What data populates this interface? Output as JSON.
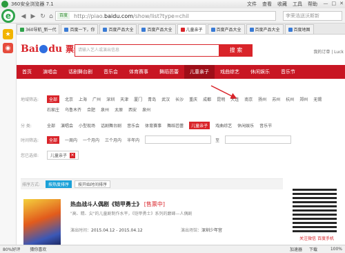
{
  "browser": {
    "title": "360安全浏览器 7.1",
    "menus": [
      "文件",
      "查看",
      "收藏",
      "工具",
      "帮助"
    ],
    "url_badge": "百度",
    "url_prefix": "http://piao.",
    "url_domain": "baidu.com",
    "url_path": "/show/list?type=chil",
    "search_placeholder": "李荣浩送沃斯新",
    "tabs": [
      {
        "label": "360导航_新一代"
      },
      {
        "label": "百度一下，你"
      },
      {
        "label": "百度产品大全"
      },
      {
        "label": "百度产品大全"
      },
      {
        "label": "儿童亲子"
      },
      {
        "label": "百度产品大全"
      },
      {
        "label": "百度产品大全"
      },
      {
        "label": "百度地图"
      }
    ]
  },
  "page": {
    "logo_text": "Bai",
    "logo_text2": "du",
    "logo_sub": "票务",
    "search_placeholder": "请输入艺人或演出信息",
    "search_button": "搜 索",
    "header_links": "我的订单 | Luck",
    "nav": [
      "首页",
      "演唱会",
      "话剧舞台剧",
      "音乐会",
      "体育赛事",
      "舞蹈芭蕾",
      "儿童亲子",
      "戏曲综艺",
      "休闲娱乐",
      "音乐节"
    ],
    "filters": {
      "city_label": "地域筛选:",
      "cities_row1": [
        "全部",
        "北京",
        "上海",
        "广州",
        "深圳",
        "天津",
        "厦门",
        "青岛",
        "武汉",
        "长沙",
        "重庆",
        "成都",
        "昆明",
        "大连",
        "南京",
        "扬州",
        "苏州",
        "杭州",
        "郑州",
        "无锡",
        "福州"
      ],
      "cities_row2": [
        "石家庄",
        "乌鲁木齐",
        "合肥",
        "泉州",
        "太原",
        "西安",
        "泉州"
      ],
      "category_label": "分   类:",
      "categories": [
        "全部",
        "演唱会",
        "小型现场",
        "话剧舞台剧",
        "音乐会",
        "体育赛事",
        "舞蹈芭蕾",
        "儿童亲子",
        "戏曲综艺",
        "休闲娱乐",
        "音乐节"
      ],
      "time_label": "时间筛选:",
      "times": [
        "全部",
        "一周内",
        "一个月内",
        "三个月内",
        "半年内"
      ],
      "to": "至",
      "selected_label": "您已选择:",
      "selected_chip": "儿童亲子"
    },
    "sort": {
      "label": "排序方式:",
      "by_recommend": "按热度排序",
      "by_time": "按开始时间排序"
    },
    "event": {
      "title": "热血战斗人偶剧《铠甲勇士》",
      "status": "[售票中]",
      "desc": "\"高、精、尖\"的儿童剧制作水平，《铠甲勇士》系列的巅峰—人偶剧",
      "time_label": "演出时间：",
      "time": "2015.04.12 - 2015.04.12",
      "venue_label": "演出场馆：",
      "venue": "深圳少年宫"
    },
    "qr_caption": "关注微信 百度手机"
  },
  "statusbar": {
    "left": [
      "80%好评",
      "猜你喜欢"
    ],
    "right": [
      "加速器",
      "下载"
    ],
    "zoom": "100%"
  }
}
